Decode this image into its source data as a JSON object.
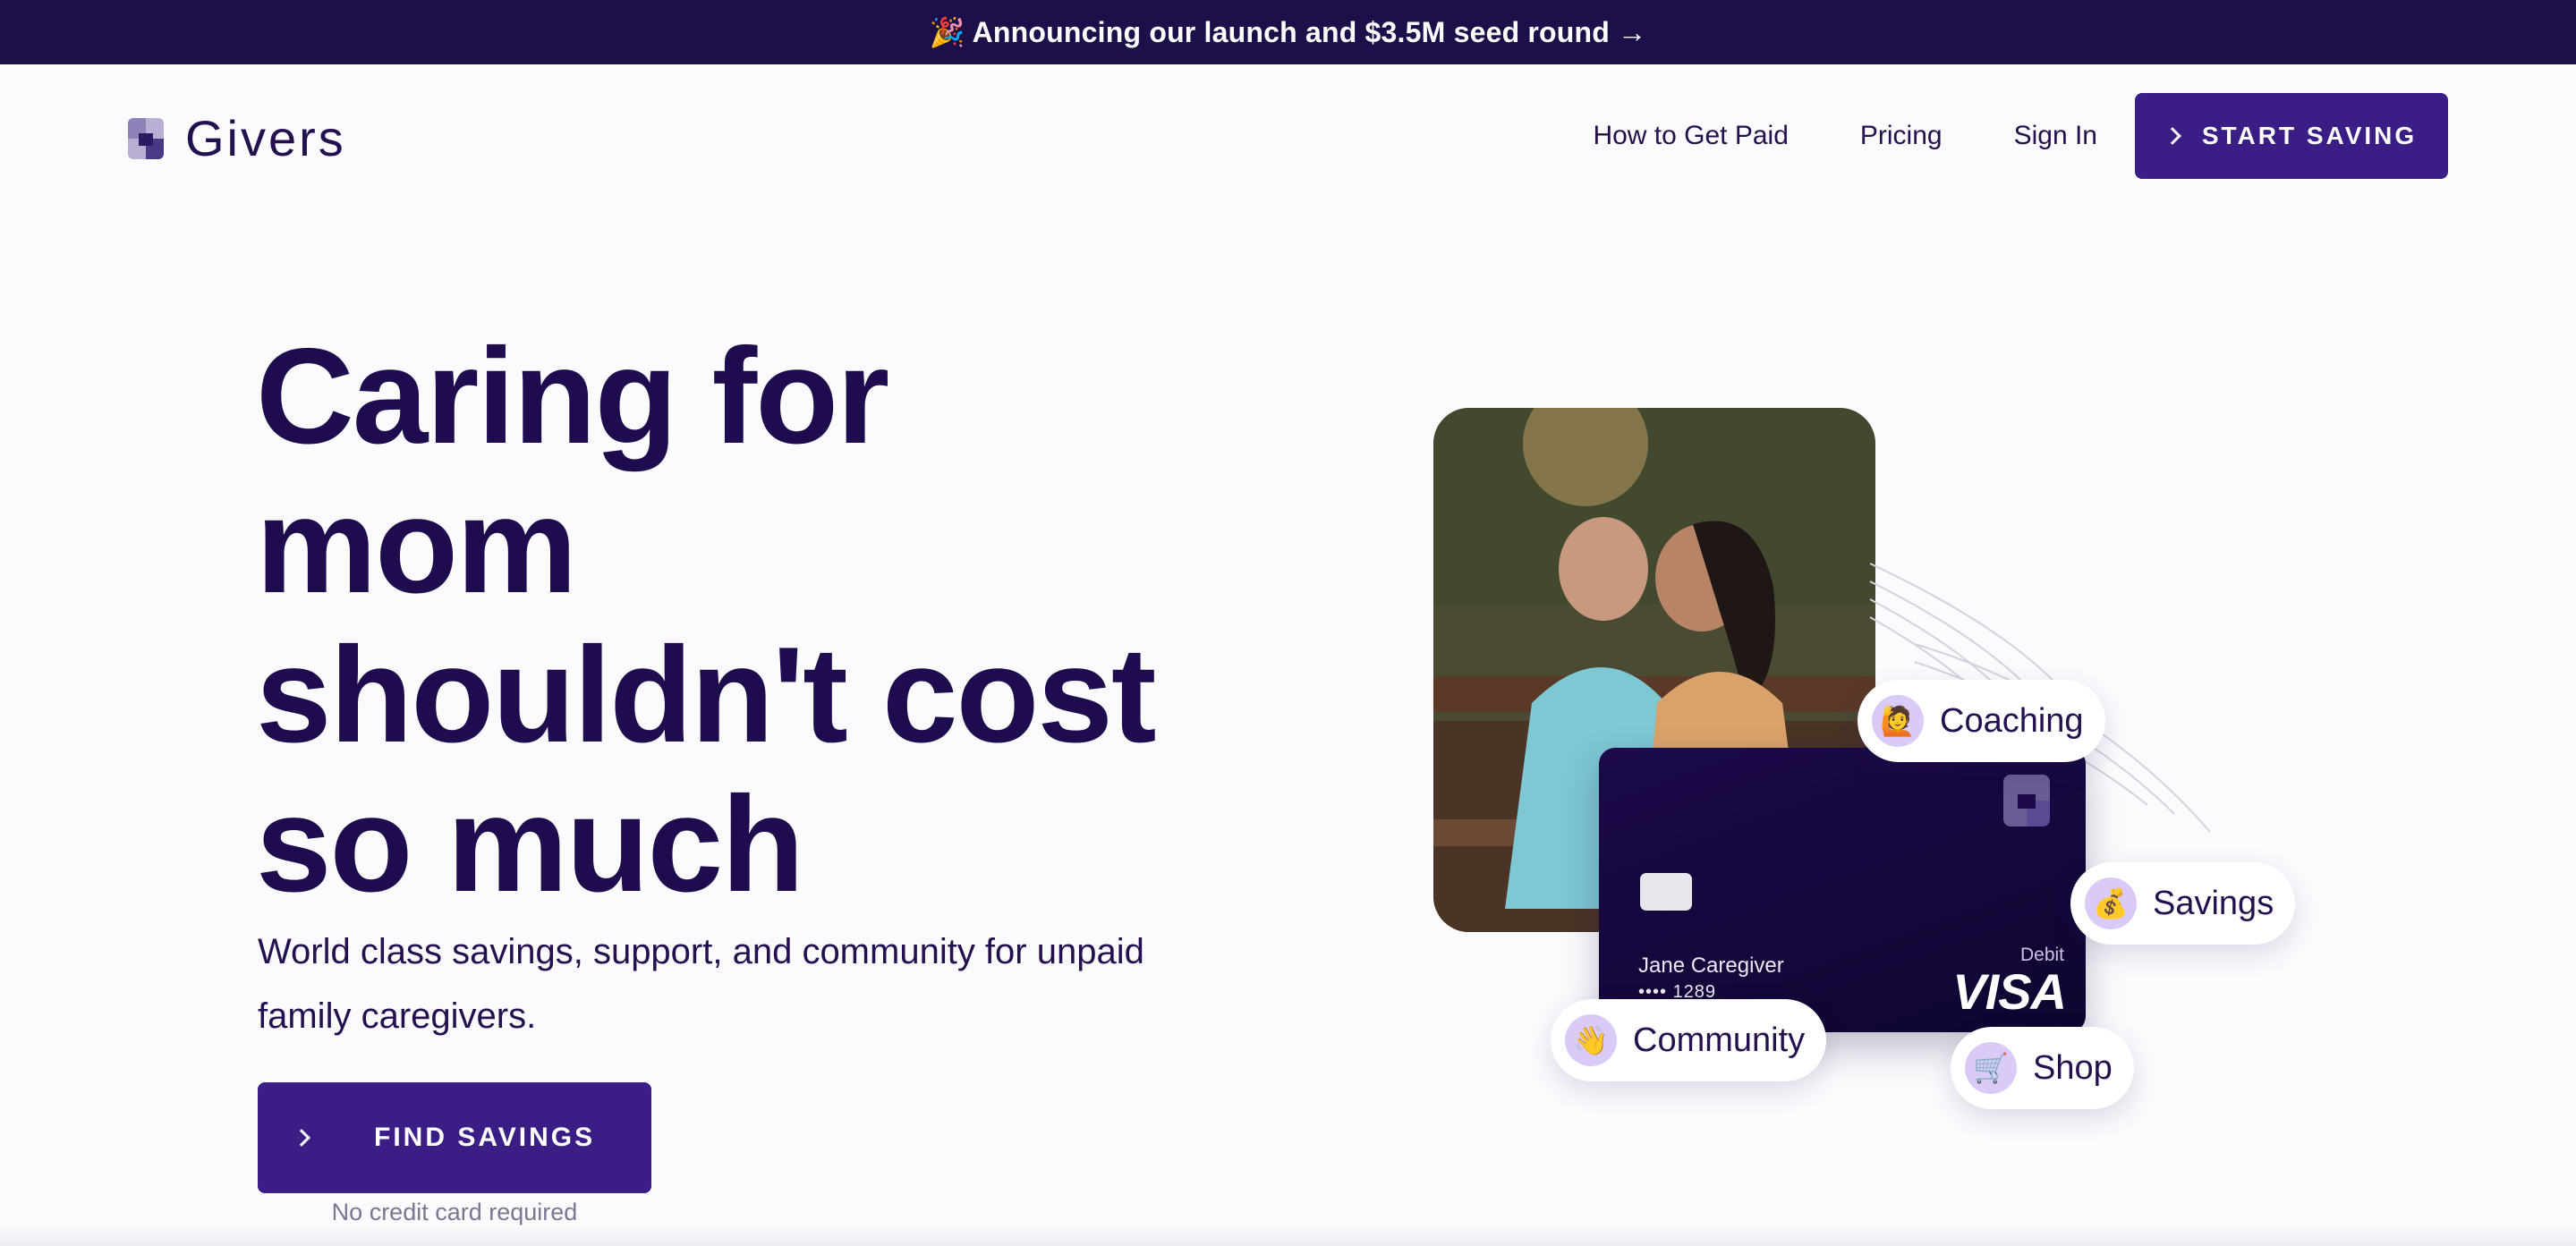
{
  "announcement": {
    "text": "🎉 Announcing our launch and $3.5M seed round →"
  },
  "brand": {
    "name": "Givers",
    "logo_icon": "givers-logo-icon",
    "primary_color": "#3a1d85",
    "dark_color": "#1e0c4f"
  },
  "nav": {
    "links": [
      {
        "label": "How to Get Paid"
      },
      {
        "label": "Pricing"
      },
      {
        "label": "Sign In"
      }
    ],
    "cta": {
      "label": "START SAVING",
      "icon": "chevron-right-icon"
    }
  },
  "hero": {
    "title_lines": [
      "Caring for",
      "mom",
      "shouldn't cost",
      "so much"
    ],
    "subtitle": "World class savings, support, and community for unpaid family caregivers.",
    "cta": {
      "label": "FIND SAVINGS",
      "icon": "chevron-right-icon"
    },
    "note": "No credit card required"
  },
  "card": {
    "holder": "Jane Caregiver",
    "number": "•••• 1289",
    "type": "Debit",
    "network": "VISA"
  },
  "pills": [
    {
      "label": "Coaching",
      "emoji": "🙋"
    },
    {
      "label": "Savings",
      "emoji": "💰"
    },
    {
      "label": "Community",
      "emoji": "👋"
    },
    {
      "label": "Shop",
      "emoji": "🛒"
    }
  ]
}
